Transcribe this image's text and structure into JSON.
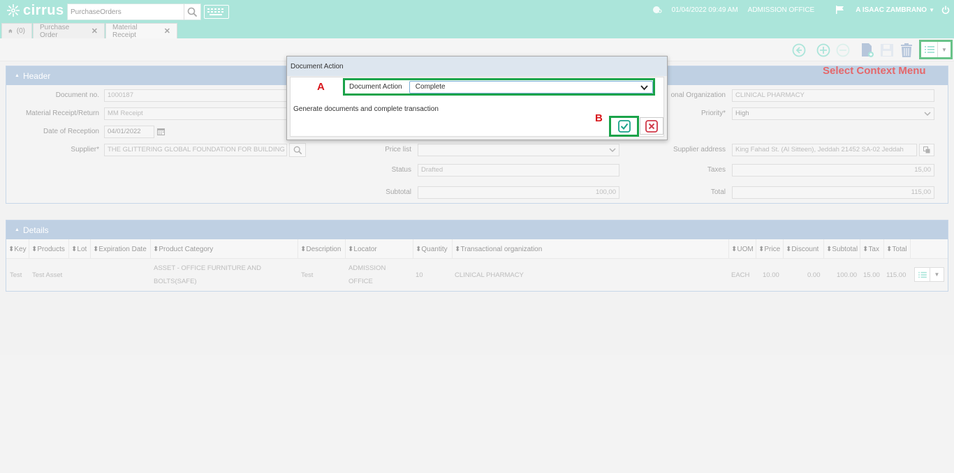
{
  "app": {
    "logo_text": "cirrus",
    "search_value": "PurchaseOrders",
    "datetime": "01/04/2022 09:49 AM",
    "office": "ADMISSION OFFICE",
    "user": "A ISAAC ZAMBRANO"
  },
  "tabs": {
    "home_count": "(0)",
    "items": [
      "Purchase Order",
      "Material Receipt"
    ]
  },
  "annotations": {
    "context_menu": "Select Context Menu",
    "a": "A",
    "b": "B"
  },
  "header": {
    "title": "Header",
    "document_no_label": "Document no.",
    "document_no": "1000187",
    "material_receipt_label": "Material Receipt/Return",
    "material_receipt": "MM Receipt",
    "date_label": "Date of Reception",
    "date": "04/01/2022",
    "supplier_label": "Supplier*",
    "supplier": "THE GLITTERING GLOBAL FOUNDATION FOR BUILDING M",
    "price_list_label": "Price list",
    "price_list": "",
    "status_label": "Status",
    "status": "Drafted",
    "subtotal_label": "Subtotal",
    "subtotal": "100,00",
    "trans_org_label": "onal Organization",
    "trans_org": "CLINICAL PHARMACY",
    "priority_label": "Priority*",
    "priority": "High",
    "supplier_address_label": "Supplier address",
    "supplier_address": "King Fahad St. (Al Sitteen),   Jeddah   21452 SA-02 Jeddah",
    "taxes_label": "Taxes",
    "taxes": "15,00",
    "total_label": "Total",
    "total": "115,00"
  },
  "details": {
    "title": "Details",
    "columns": [
      "Key",
      "Products",
      "Lot",
      "Expiration Date",
      "Product Category",
      "Description",
      "Locator",
      "Quantity",
      "Transactional organization",
      "UOM",
      "Price",
      "Discount",
      "Subtotal",
      "Tax",
      "Total"
    ],
    "row": {
      "key": "Test",
      "product": "Test Asset",
      "lot": "",
      "expiration": "",
      "category": "ASSET - OFFICE FURNITURE AND BOLTS(SAFE)",
      "description": "Test",
      "locator": "ADMISSION OFFICE",
      "quantity": "10",
      "trans_org": "CLINICAL PHARMACY",
      "uom": "EACH",
      "price": "10.00",
      "discount": "0.00",
      "subtotal": "100.00",
      "tax": "15.00",
      "total": "115.00"
    }
  },
  "dialog": {
    "title": "Document Action",
    "field_label": "Document Action",
    "field_value": "Complete",
    "description": "Generate documents and complete transaction"
  },
  "colors": {
    "brand": "#7fd8c6",
    "panel_head": "#9db7d4",
    "annotation_red": "#d8161b",
    "highlight_green": "#1aa34a"
  }
}
